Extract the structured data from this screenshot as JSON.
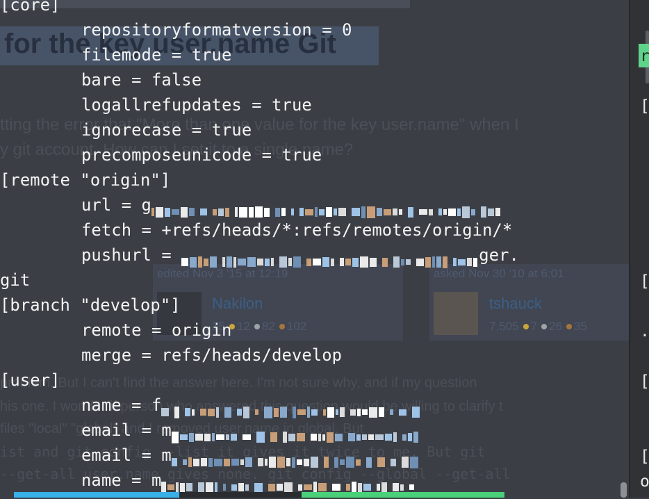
{
  "background_page": {
    "title": "for the key user.name Git",
    "question_line1": "tting the error that \"More than one value for the key user.name\" when I",
    "question_line2": "y git account. How can I set it to a single name?",
    "edited": "edited Nov 3 '15 at 12:19",
    "edited_user": "Nakilon",
    "edited_rep": "15",
    "edited_badges": [
      "12",
      "82",
      "102"
    ],
    "asked": "asked Nov 30 '10 at 6:01",
    "asked_user": "tshauck",
    "asked_rep": "7,505",
    "asked_badges": [
      "7",
      "26",
      "35"
    ],
    "answer_line1": "problem. But I can't find the answer here. I'm not sure why, and if my question",
    "answer_line2": "his one. I wonder if person who answered this question would be willing to clarify t",
    "answer_line3": "files \"local\" \"global\" and I removed user.name in global. But",
    "answer_line4": "ist  and  git config  --list  it gives it twice to me. But  git",
    "answer_line5": "--get-all user.name gives none.  git config --global --get-all"
  },
  "terminal": {
    "lines": [
      {
        "text": "[core]",
        "indent": false
      },
      {
        "text": "repositoryformatversion = 0",
        "indent": true
      },
      {
        "text": "filemode = true",
        "indent": true
      },
      {
        "text": "bare = false",
        "indent": true
      },
      {
        "text": "logallrefupdates = true",
        "indent": true
      },
      {
        "text": "ignorecase = true",
        "indent": true
      },
      {
        "text": "precomposeunicode = true",
        "indent": true
      },
      {
        "text": "[remote \"origin\"]",
        "indent": false
      },
      {
        "text": "url = g",
        "indent": true,
        "redacted": true
      },
      {
        "text": "fetch = +refs/heads/*:refs/remotes/origin/*",
        "indent": true
      },
      {
        "text": "pushurl = ",
        "indent": true,
        "redacted": true,
        "suffix": "ger."
      },
      {
        "text": "git",
        "indent": false
      },
      {
        "text": "[branch \"develop\"]",
        "indent": false
      },
      {
        "text": "remote = origin",
        "indent": true
      },
      {
        "text": "merge = refs/heads/develop",
        "indent": true
      },
      {
        "text": "[user]",
        "indent": false
      },
      {
        "text": "name = f",
        "indent": true,
        "redacted": true
      },
      {
        "text": "email = m",
        "indent": true,
        "redacted": true
      },
      {
        "text": "email = m",
        "indent": true,
        "redacted": true
      },
      {
        "text": "name = m",
        "indent": true,
        "redacted": true
      }
    ]
  },
  "right_pane": {
    "glyphs": [
      "r",
      "[",
      "[",
      ".",
      "[",
      "[",
      "o"
    ]
  },
  "colors": {
    "terminal_bg": "#3b3e44",
    "terminal_text": "#f4f4f4",
    "pane_highlight": "#5fd38a",
    "tab_blue": "#38b0e8",
    "tab_green": "#49d17a"
  }
}
